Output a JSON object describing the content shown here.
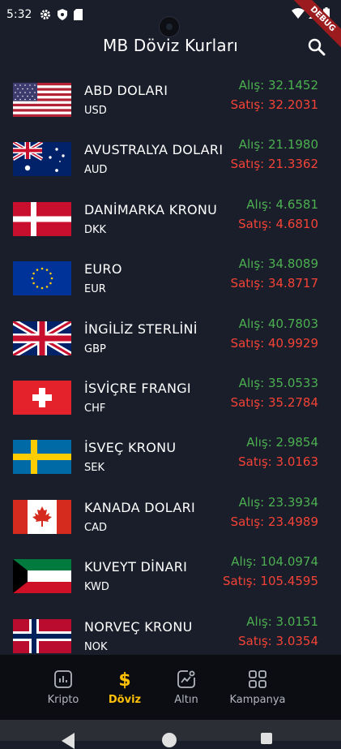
{
  "status_bar": {
    "time": "5:32"
  },
  "debug_banner": "DEBUG",
  "app_title": "MB Döviz Kurları",
  "currencies": [
    {
      "name": "ABD DOLARI",
      "code": "USD",
      "buy": "Alış: 32.1452",
      "sell": "Satış: 32.2031",
      "flag": "us-flag"
    },
    {
      "name": "AVUSTRALYA DOLARI",
      "code": "AUD",
      "buy": "Alış: 21.1980",
      "sell": "Satış: 21.3362",
      "flag": "au-flag"
    },
    {
      "name": "DANİMARKA KRONU",
      "code": "DKK",
      "buy": "Alış: 4.6581",
      "sell": "Satış: 4.6810",
      "flag": "dk-flag"
    },
    {
      "name": "EURO",
      "code": "EUR",
      "buy": "Alış: 34.8089",
      "sell": "Satış: 34.8717",
      "flag": "eu-flag"
    },
    {
      "name": "İNGİLİZ STERLİNİ",
      "code": "GBP",
      "buy": "Alış: 40.7803",
      "sell": "Satış: 40.9929",
      "flag": "gb-flag"
    },
    {
      "name": "İSVİÇRE FRANGI",
      "code": "CHF",
      "buy": "Alış: 35.0533",
      "sell": "Satış: 35.2784",
      "flag": "ch-flag"
    },
    {
      "name": "İSVEÇ KRONU",
      "code": "SEK",
      "buy": "Alış: 2.9854",
      "sell": "Satış: 3.0163",
      "flag": "se-flag"
    },
    {
      "name": "KANADA DOLARI",
      "code": "CAD",
      "buy": "Alış: 23.3934",
      "sell": "Satış: 23.4989",
      "flag": "ca-flag"
    },
    {
      "name": "KUVEYT DİNARI",
      "code": "KWD",
      "buy": "Alış: 104.0974",
      "sell": "Satış: 105.4595",
      "flag": "kw-flag"
    },
    {
      "name": "NORVEÇ KRONU",
      "code": "NOK",
      "buy": "Alış: 3.0151",
      "sell": "Satış: 3.0354",
      "flag": "no-flag"
    }
  ],
  "bottom_nav": {
    "items": [
      {
        "label": "Kripto",
        "icon": "chart-icon"
      },
      {
        "label": "Döviz",
        "icon": "dollar-icon",
        "active": true
      },
      {
        "label": "Altın",
        "icon": "trend-icon"
      },
      {
        "label": "Kampanya",
        "icon": "grid-icon"
      }
    ]
  },
  "colors": {
    "background": "#1a1e2b",
    "buy": "#4caf50",
    "sell": "#f44336",
    "active_nav": "#ffc107"
  }
}
